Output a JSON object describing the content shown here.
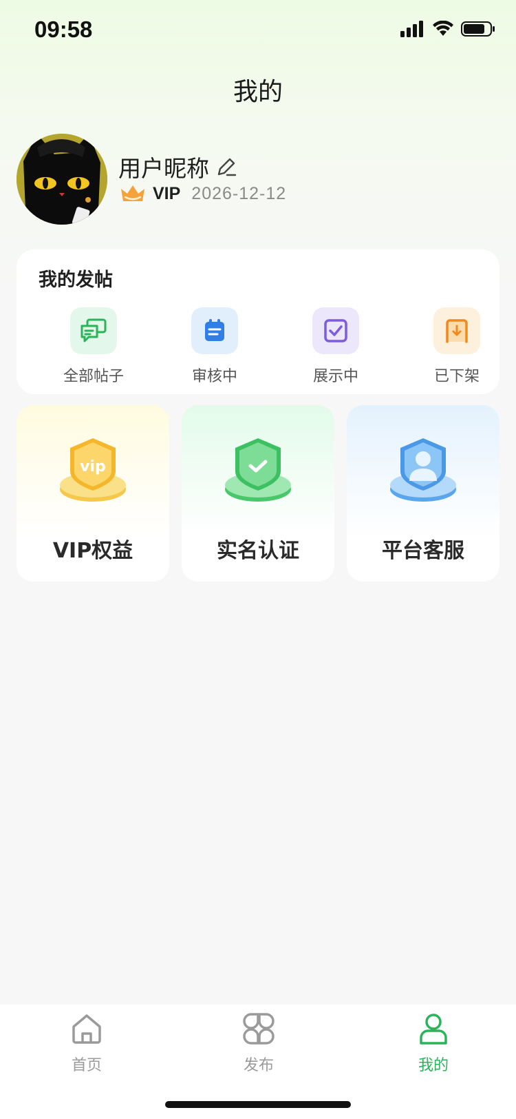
{
  "status_bar": {
    "time": "09:58"
  },
  "header": {
    "title": "我的"
  },
  "profile": {
    "nickname": "用户昵称",
    "vip_label": "VIP",
    "vip_expiry": "2026-12-12"
  },
  "posts": {
    "title": "我的发帖",
    "items": [
      {
        "label": "全部帖子",
        "icon": "chat-bubbles-icon",
        "color": "#2bb35a"
      },
      {
        "label": "审核中",
        "icon": "clipboard-icon",
        "color": "#2f7fe6"
      },
      {
        "label": "展示中",
        "icon": "checkbox-icon",
        "color": "#7b5ce0"
      },
      {
        "label": "已下架",
        "icon": "download-box-icon",
        "color": "#f08a1c"
      }
    ]
  },
  "features": [
    {
      "label": "VIP权益",
      "icon": "vip-badge-icon"
    },
    {
      "label": "实名认证",
      "icon": "shield-check-icon"
    },
    {
      "label": "平台客服",
      "icon": "customer-service-icon"
    }
  ],
  "tabbar": {
    "items": [
      {
        "label": "首页",
        "icon": "home-icon"
      },
      {
        "label": "发布",
        "icon": "grid-icon"
      },
      {
        "label": "我的",
        "icon": "user-icon",
        "active": true
      }
    ],
    "active_color": "#2bb35a",
    "inactive_color": "#9a9a9a"
  }
}
